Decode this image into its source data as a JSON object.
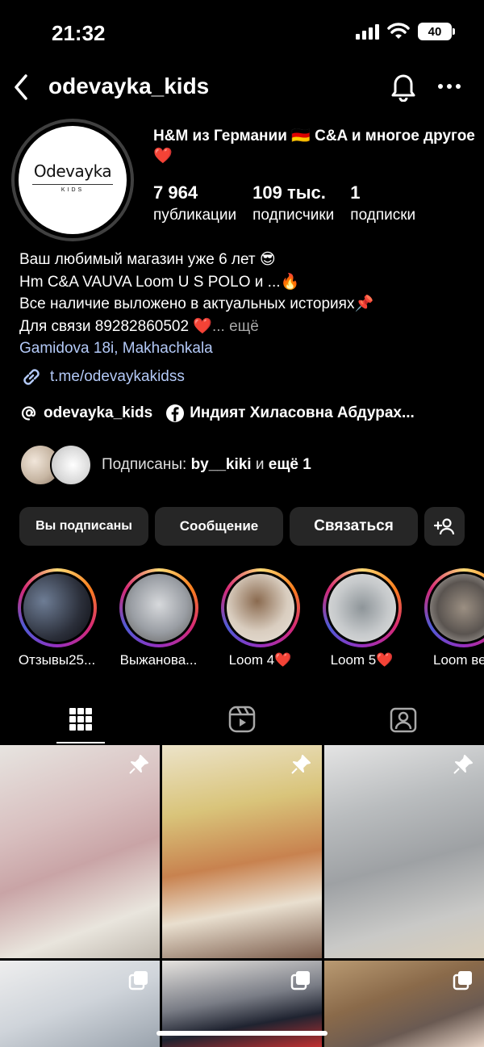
{
  "status_bar": {
    "time": "21:32",
    "battery": "40"
  },
  "header": {
    "username": "odevayka_kids"
  },
  "avatar": {
    "logo_main": "Odevayka",
    "logo_sub": "KIDS"
  },
  "profile": {
    "category": "H&M из Германии 🇩🇪 C&A и многое другое ❤️",
    "stats": [
      {
        "value": "7 964",
        "label": "публикации"
      },
      {
        "value": "109 тыс.",
        "label": "подписчики"
      },
      {
        "value": "1",
        "label": "подписки"
      }
    ],
    "bio_lines": [
      "Ваш любимый магазин уже 6 лет 😎",
      "Hm C&A VAUVA Loom U S POLO и ...🔥",
      "Все наличие выложено в актуальных историях📌",
      "Для связи 89282860502 ❤️"
    ],
    "bio_more": "... ещё",
    "location": "Gamidova 18i, Makhachkala",
    "link": "t.me/odevaykakidss",
    "threads_handle": "odevayka_kids",
    "facebook_name": "Индият Хиласовна Абдурах..."
  },
  "followed_by": {
    "prefix": "Подписаны: ",
    "user": "by__kiki",
    "middle": " и ",
    "more": "ещё 1"
  },
  "buttons": {
    "subscribed": "Вы подписаны",
    "message": "Сообщение",
    "contact": "Связаться"
  },
  "highlights": [
    {
      "label": "Отзывы25..."
    },
    {
      "label": "Выжанова..."
    },
    {
      "label": "Loom 4❤️"
    },
    {
      "label": "Loom 5❤️"
    },
    {
      "label": "Loom вер"
    }
  ],
  "tabs": [
    "grid",
    "reels",
    "tagged"
  ],
  "colors": {
    "link": "#b3c9f7",
    "button_bg": "#262626",
    "muted": "#a8a8a8"
  }
}
